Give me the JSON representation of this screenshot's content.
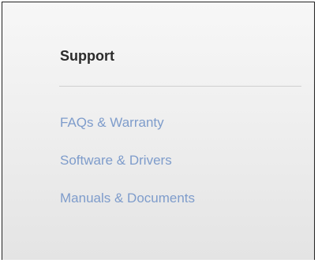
{
  "support": {
    "title": "Support",
    "links": [
      {
        "label": "FAQs & Warranty"
      },
      {
        "label": "Software & Drivers"
      },
      {
        "label": "Manuals & Documents"
      }
    ]
  },
  "colors": {
    "heading": "#2b2b2b",
    "link": "#7e9ccb",
    "divider": "#cfcfcf",
    "border": "#222222",
    "panel_background": "#efefef"
  }
}
